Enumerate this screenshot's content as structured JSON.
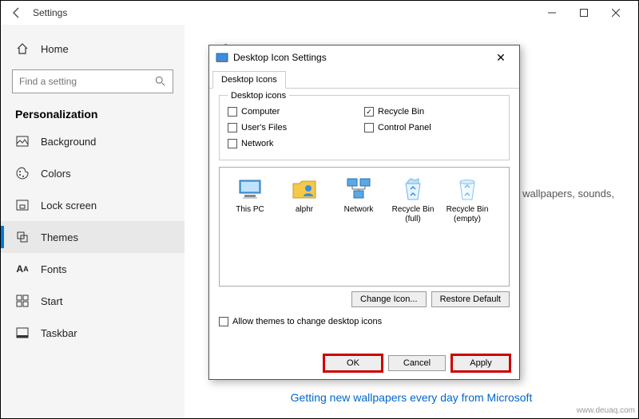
{
  "settings": {
    "title": "Settings",
    "search_placeholder": "Find a setting",
    "home": "Home",
    "category": "Personalization",
    "items": [
      {
        "label": "Background"
      },
      {
        "label": "Colors"
      },
      {
        "label": "Lock screen"
      },
      {
        "label": "Themes"
      },
      {
        "label": "Fonts"
      },
      {
        "label": "Start"
      },
      {
        "label": "Taskbar"
      }
    ],
    "partial_heading": "Tl",
    "partial_text": "ombine wallpapers, sounds,",
    "link": "Getting new wallpapers every day from Microsoft"
  },
  "dialog": {
    "title": "Desktop Icon Settings",
    "tab": "Desktop Icons",
    "group_label": "Desktop icons",
    "checks": {
      "computer": {
        "label": "Computer",
        "checked": false
      },
      "users_files": {
        "label": "User's Files",
        "checked": false
      },
      "network": {
        "label": "Network",
        "checked": false
      },
      "recycle_bin": {
        "label": "Recycle Bin",
        "checked": true
      },
      "control_panel": {
        "label": "Control Panel",
        "checked": false
      }
    },
    "icons": [
      {
        "label": "This PC"
      },
      {
        "label": "alphr"
      },
      {
        "label": "Network"
      },
      {
        "label": "Recycle Bin (full)"
      },
      {
        "label": "Recycle Bin (empty)"
      }
    ],
    "change_icon": "Change Icon...",
    "restore_default": "Restore Default",
    "allow_themes": {
      "label": "Allow themes to change desktop icons",
      "checked": false
    },
    "ok": "OK",
    "cancel": "Cancel",
    "apply": "Apply"
  },
  "watermark": "www.deuaq.com"
}
